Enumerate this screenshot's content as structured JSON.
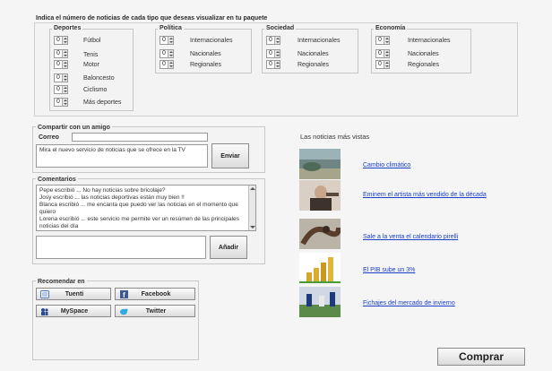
{
  "header": {
    "title": "Indica el número de noticias de cada tipo que deseas visualizar en tu paquete"
  },
  "categories": [
    {
      "name": "Deportes",
      "items": [
        "Fútbol",
        "Tenis",
        "Motor",
        "Baloncesto",
        "Ciclismo",
        "Más deportes"
      ]
    },
    {
      "name": "Política",
      "items": [
        "Internacionales",
        "Nacionales",
        "Regionales"
      ]
    },
    {
      "name": "Sociedad",
      "items": [
        "Internacionales",
        "Nacionales",
        "Regionales"
      ]
    },
    {
      "name": "Economía",
      "items": [
        "Internacionales",
        "Nacionales",
        "Regionales"
      ]
    }
  ],
  "spinner_value": "0",
  "share": {
    "title": "Compartir con un amigo",
    "email_label": "Correo",
    "email_value": "",
    "message": "Mira el nuevo servicio de noticias que se ofrece en la TV",
    "send_label": "Enviar"
  },
  "comments": {
    "title": "Comentarios",
    "lines": [
      "Pepe escribió ... No hay noticias sobre bricolaje?",
      "Josy escribió ... las noticias deportivas están muy bien !!",
      "Blanca escribió ... me encanta que puedo ver las noticias en el momento que quiero",
      "Lorena escribió ... este servicio me permite ver un resúmen de las principales noticias del día"
    ],
    "input_value": "",
    "add_label": "Añadir"
  },
  "recommend": {
    "title": "Recomendar en",
    "buttons": [
      {
        "label": "Tuenti",
        "icon": "tuenti-icon",
        "color": "#4a7bbf"
      },
      {
        "label": "Facebook",
        "icon": "facebook-icon",
        "color": "#3b5998"
      },
      {
        "label": "MySpace",
        "icon": "myspace-icon",
        "color": "#2a4d8f"
      },
      {
        "label": "Twitter",
        "icon": "twitter-icon",
        "color": "#33aadd"
      }
    ]
  },
  "news": {
    "title": "Las noticias más vistas",
    "items": [
      {
        "headline": "Cambio climático",
        "thumb": "landscape-thumbnail"
      },
      {
        "headline": "Eminem el artista más vendido de la década",
        "thumb": "singer-thumbnail"
      },
      {
        "headline": "Sale a la venta el calendario pirelli",
        "thumb": "calendar-thumbnail"
      },
      {
        "headline": "El PIB sube un 3%",
        "thumb": "coins-thumbnail"
      },
      {
        "headline": "Fichajes del mercado de invierno",
        "thumb": "football-thumbnail"
      }
    ]
  },
  "buy_label": "Comprar"
}
